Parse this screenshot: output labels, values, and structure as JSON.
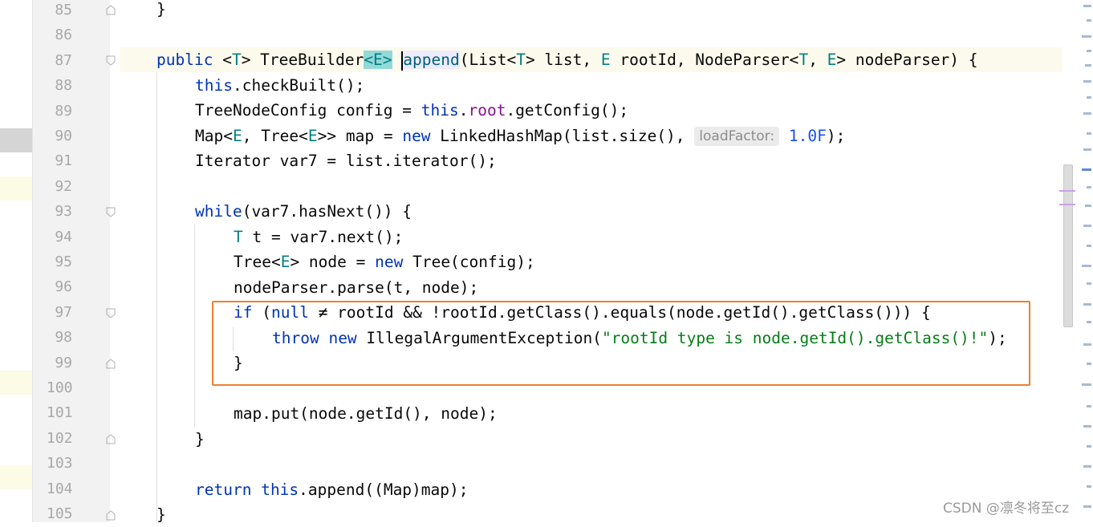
{
  "editor": {
    "line_numbers": [
      "85",
      "86",
      "87",
      "88",
      "89",
      "90",
      "91",
      "92",
      "93",
      "94",
      "95",
      "96",
      "97",
      "98",
      "99",
      "100",
      "101",
      "102",
      "103",
      "104",
      "105"
    ],
    "code": {
      "l85_brace": "}",
      "l87_public": "public ",
      "l87_lt": "<",
      "l87_T": "T",
      "l87_gt": "> ",
      "l87_treebuilder": "TreeBuilder",
      "l87_E": "<E>",
      "l87_space": " ",
      "l87_append": "append",
      "l87_params_a": "(List<",
      "l87_T2": "T",
      "l87_params_b": "> list, ",
      "l87_E2": "E",
      "l87_params_c": " rootId, NodeParser<",
      "l87_T3": "T",
      "l87_comma": ", ",
      "l87_E3": "E",
      "l87_params_d": "> nodeParser) {",
      "l88_this": "this",
      "l88_rest": ".checkBuilt();",
      "l89_a": "TreeNodeConfig config = ",
      "l89_this": "this",
      "l89_dot": ".",
      "l89_root": "root",
      "l89_rest": ".getConfig();",
      "l90_a": "Map<",
      "l90_E": "E",
      "l90_b": ", Tree<",
      "l90_E2": "E",
      "l90_c": ">> map = ",
      "l90_new": "new",
      "l90_d": " LinkedHashMap(list.size(), ",
      "l90_hint": "loadFactor:",
      "l90_num": "1.0F",
      "l90_end": ");",
      "l91": "Iterator var7 = list.iterator();",
      "l93_while": "while",
      "l93_rest": "(var7.hasNext()) {",
      "l94_T": "T",
      "l94_rest": " t = var7.next();",
      "l95_a": "Tree<",
      "l95_E": "E",
      "l95_b": "> node = ",
      "l95_new": "new",
      "l95_c": " Tree(config);",
      "l96": "nodeParser.parse(t, node);",
      "l97_if": "if",
      "l97_paren": " (",
      "l97_null": "null",
      "l97_rest": " ≠ rootId && !rootId.getClass().equals(node.getId().getClass())) {",
      "l98_throw": "throw",
      "l98_sp": " ",
      "l98_new": "new",
      "l98_a": " IllegalArgumentException(",
      "l98_str": "\"rootId type is node.getId().getClass()!\"",
      "l98_end": ");",
      "l99": "}",
      "l101": "map.put(node.getId(), node);",
      "l102": "}",
      "l104_return": "return",
      "l104_sp": " ",
      "l104_this": "this",
      "l104_rest": ".append((Map)map);",
      "l105": "}"
    }
  },
  "colors": {
    "keyword": "#0033b3",
    "type_param": "#008080",
    "field": "#871094",
    "string": "#067d17",
    "number": "#1750eb",
    "highlight_box": "#ee7f2d",
    "current_line": "#fcfaed"
  },
  "watermark": "CSDN @凛冬将至cz"
}
